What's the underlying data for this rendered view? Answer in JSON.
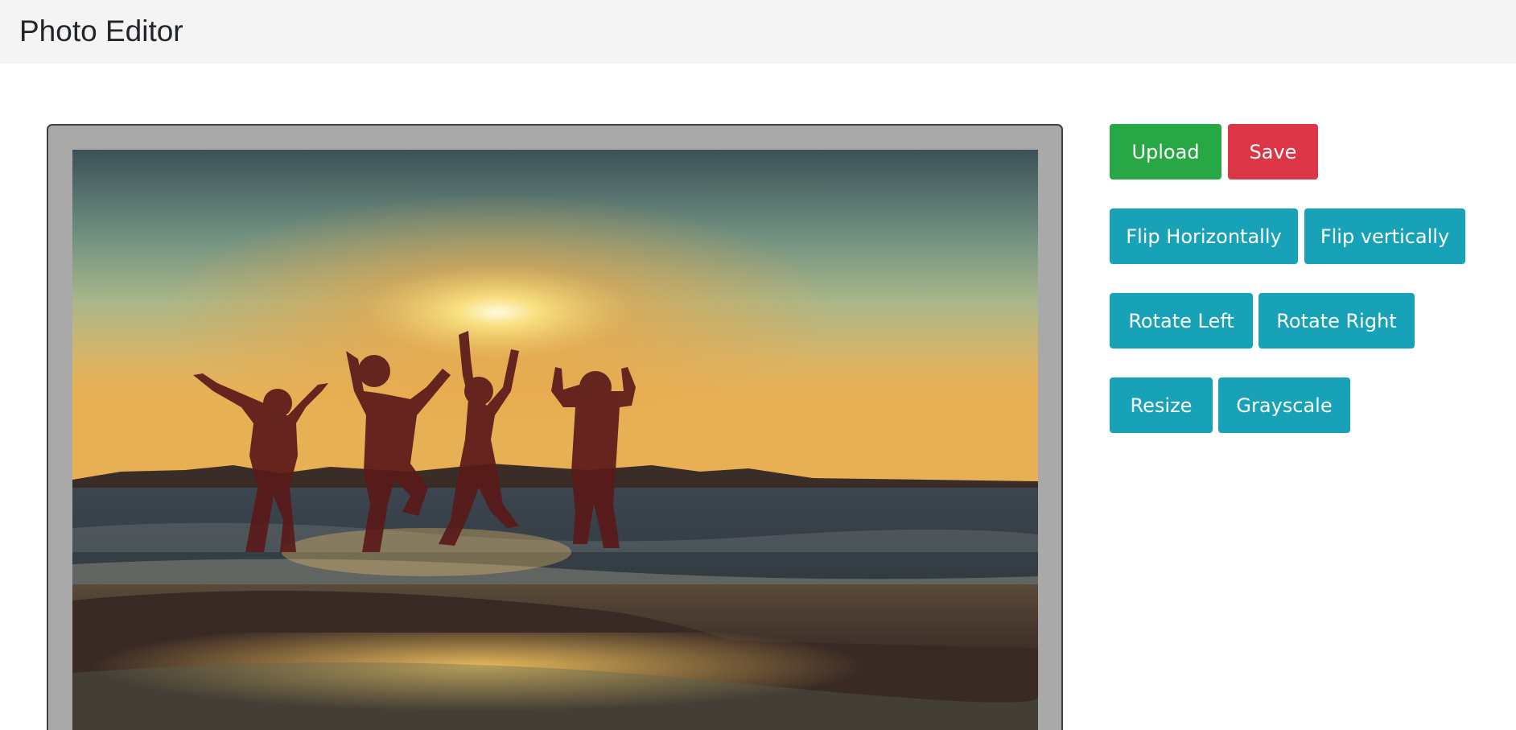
{
  "header": {
    "title": "Photo Editor"
  },
  "toolbar": {
    "upload_label": "Upload",
    "save_label": "Save",
    "flip_h_label": "Flip Horizontally",
    "flip_v_label": "Flip vertically",
    "rotate_left_label": "Rotate Left",
    "rotate_right_label": "Rotate Right",
    "resize_label": "Resize",
    "grayscale_label": "Grayscale"
  },
  "colors": {
    "upload": "#28a745",
    "save": "#dc3545",
    "tool": "#17a2b8",
    "frame": "#a9a9a9"
  }
}
